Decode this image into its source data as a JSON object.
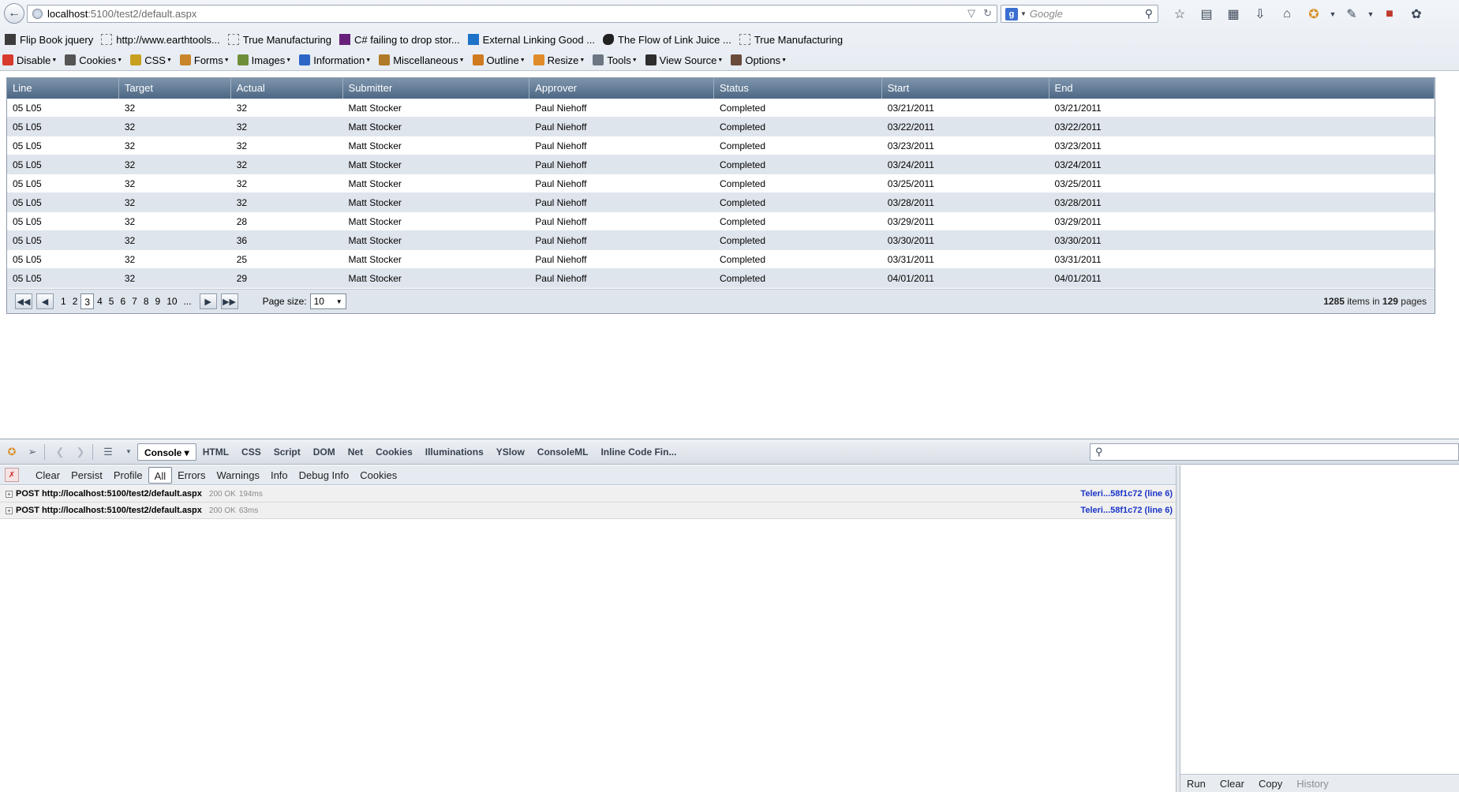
{
  "browser": {
    "url_host": "localhost",
    "url_rest": ":5100/test2/default.aspx",
    "search_placeholder": "Google"
  },
  "bookmarks": [
    {
      "label": "Flip Book jquery",
      "icon": "book-icon"
    },
    {
      "label": "http://www.earthtools...",
      "icon": "page-icon"
    },
    {
      "label": "True Manufacturing",
      "icon": "page-icon"
    },
    {
      "label": "C# failing to drop stor...",
      "icon": "visual-studio-icon"
    },
    {
      "label": "External Linking Good ...",
      "icon": "mail-icon"
    },
    {
      "label": "The Flow of Link Juice ...",
      "icon": "ink-blot-icon"
    },
    {
      "label": "True Manufacturing",
      "icon": "page-icon"
    }
  ],
  "webdev": [
    {
      "label": "Disable",
      "color": "#d83a2e"
    },
    {
      "label": "Cookies",
      "color": "#555555"
    },
    {
      "label": "CSS",
      "color": "#c8a020"
    },
    {
      "label": "Forms",
      "color": "#c9852a"
    },
    {
      "label": "Images",
      "color": "#6f8e3a"
    },
    {
      "label": "Information",
      "color": "#2b66c7"
    },
    {
      "label": "Miscellaneous",
      "color": "#b07a28"
    },
    {
      "label": "Outline",
      "color": "#d07a20"
    },
    {
      "label": "Resize",
      "color": "#e08c2a"
    },
    {
      "label": "Tools",
      "color": "#6d7683"
    },
    {
      "label": "View Source",
      "color": "#2d2d2d"
    },
    {
      "label": "Options",
      "color": "#6a4a3a"
    }
  ],
  "grid": {
    "columns": [
      "Line",
      "Target",
      "Actual",
      "Submitter",
      "Approver",
      "Status",
      "Start",
      "End"
    ],
    "rows": [
      [
        "05 L05",
        "32",
        "32",
        "Matt Stocker",
        "Paul Niehoff",
        "Completed",
        "03/21/2011",
        "03/21/2011"
      ],
      [
        "05 L05",
        "32",
        "32",
        "Matt Stocker",
        "Paul Niehoff",
        "Completed",
        "03/22/2011",
        "03/22/2011"
      ],
      [
        "05 L05",
        "32",
        "32",
        "Matt Stocker",
        "Paul Niehoff",
        "Completed",
        "03/23/2011",
        "03/23/2011"
      ],
      [
        "05 L05",
        "32",
        "32",
        "Matt Stocker",
        "Paul Niehoff",
        "Completed",
        "03/24/2011",
        "03/24/2011"
      ],
      [
        "05 L05",
        "32",
        "32",
        "Matt Stocker",
        "Paul Niehoff",
        "Completed",
        "03/25/2011",
        "03/25/2011"
      ],
      [
        "05 L05",
        "32",
        "32",
        "Matt Stocker",
        "Paul Niehoff",
        "Completed",
        "03/28/2011",
        "03/28/2011"
      ],
      [
        "05 L05",
        "32",
        "28",
        "Matt Stocker",
        "Paul Niehoff",
        "Completed",
        "03/29/2011",
        "03/29/2011"
      ],
      [
        "05 L05",
        "32",
        "36",
        "Matt Stocker",
        "Paul Niehoff",
        "Completed",
        "03/30/2011",
        "03/30/2011"
      ],
      [
        "05 L05",
        "32",
        "25",
        "Matt Stocker",
        "Paul Niehoff",
        "Completed",
        "03/31/2011",
        "03/31/2011"
      ],
      [
        "05 L05",
        "32",
        "29",
        "Matt Stocker",
        "Paul Niehoff",
        "Completed",
        "04/01/2011",
        "04/01/2011"
      ]
    ],
    "pager": {
      "pages": [
        "1",
        "2",
        "3",
        "4",
        "5",
        "6",
        "7",
        "8",
        "9",
        "10",
        "..."
      ],
      "current_page": "3",
      "page_size_label": "Page size:",
      "page_size_value": "10",
      "total_items": "1285",
      "items_in_text": "items in",
      "total_pages": "129",
      "pages_text": "pages"
    }
  },
  "firebug": {
    "tabs": [
      "Console",
      "HTML",
      "CSS",
      "Script",
      "DOM",
      "Net",
      "Cookies",
      "Illuminations",
      "YSlow",
      "ConsoleML",
      "Inline Code Fin..."
    ],
    "active_tab": "Console",
    "filters": [
      "Clear",
      "Persist",
      "Profile",
      "All",
      "Errors",
      "Warnings",
      "Info",
      "Debug Info",
      "Cookies"
    ],
    "active_filter": "All",
    "log": [
      {
        "method": "POST",
        "url": "http://localhost:5100/test2/default.aspx",
        "status": "200 OK",
        "time": "194ms",
        "source": "Teleri...58f1c72 (line 6)"
      },
      {
        "method": "POST",
        "url": "http://localhost:5100/test2/default.aspx",
        "status": "200 OK",
        "time": "63ms",
        "source": "Teleri...58f1c72 (line 6)"
      }
    ],
    "command_buttons": [
      "Run",
      "Clear",
      "Copy",
      "History"
    ]
  }
}
